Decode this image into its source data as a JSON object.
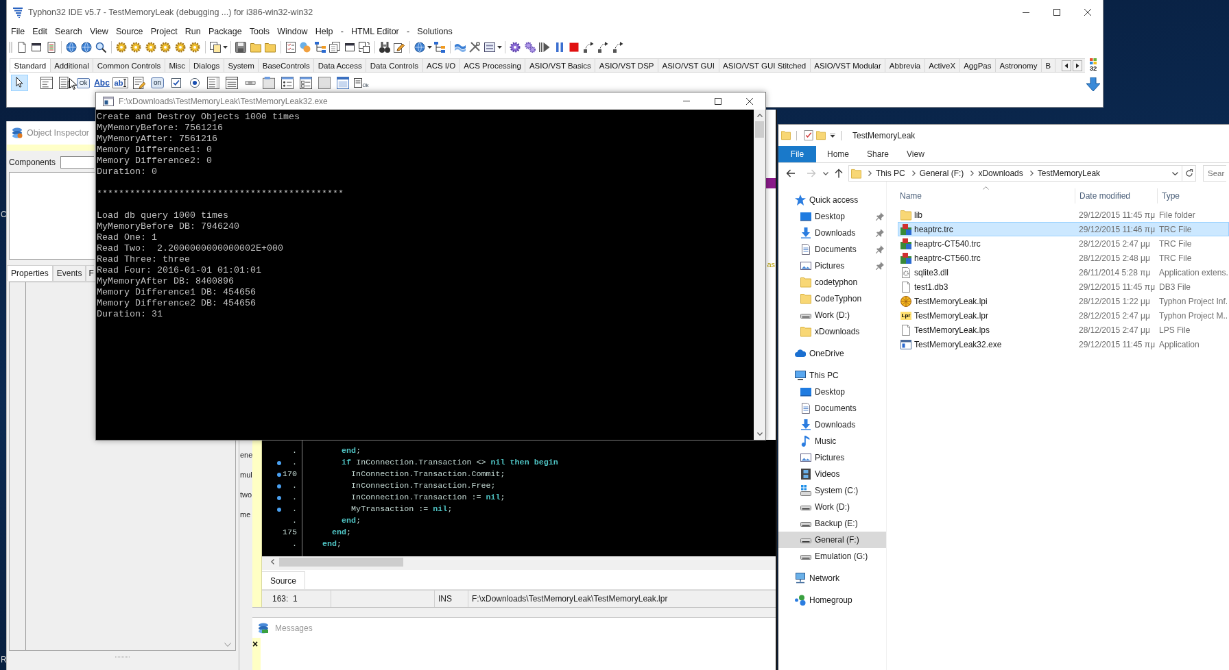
{
  "desktop": {
    "label_fragments": [
      "C",
      "R"
    ]
  },
  "ide_window": {
    "title": "Typhon32 IDE v5.7 - TestMemoryLeak (debugging ...) for i386-win32-win32",
    "menu": [
      "File",
      "Edit",
      "Search",
      "View",
      "Source",
      "Project",
      "Run",
      "Package",
      "Tools",
      "Window",
      "Help",
      "-",
      "HTML Editor",
      "-",
      "Solutions"
    ],
    "palette_tabs": [
      {
        "label": "Standard",
        "selected": true
      },
      {
        "label": "Additional",
        "selected": false
      },
      {
        "label": "Common Controls",
        "selected": false
      },
      {
        "label": "Misc",
        "selected": false
      },
      {
        "label": "Dialogs",
        "selected": false
      },
      {
        "label": "System",
        "selected": false
      },
      {
        "label": "BaseControls",
        "selected": false
      },
      {
        "label": "Data Access",
        "selected": false
      },
      {
        "label": "Data Controls",
        "selected": false
      },
      {
        "label": "ACS I/O",
        "selected": false
      },
      {
        "label": "ACS Processing",
        "selected": false
      },
      {
        "label": "ASIO/VST Basics",
        "selected": false
      },
      {
        "label": "ASIO/VST DSP",
        "selected": false
      },
      {
        "label": "ASIO/VST GUI",
        "selected": false
      },
      {
        "label": "ASIO/VST GUI Stitched",
        "selected": false
      },
      {
        "label": "ASIO/VST Modular",
        "selected": false
      },
      {
        "label": "Abbrevia",
        "selected": false
      },
      {
        "label": "ActiveX",
        "selected": false
      },
      {
        "label": "AggPas",
        "selected": false
      },
      {
        "label": "Astronomy",
        "selected": false
      },
      {
        "label": "B",
        "selected": false
      }
    ],
    "palette_items": [
      {
        "kind": "pointer",
        "selected": true
      },
      {
        "kind": "menu",
        "selected": false
      },
      {
        "kind": "popup",
        "selected": false
      },
      {
        "kind": "button",
        "glyph": "Ok",
        "selected": false
      },
      {
        "kind": "label",
        "glyph": "Abc",
        "selected": false
      },
      {
        "kind": "edit",
        "glyph": "ab",
        "selected": false
      },
      {
        "kind": "memo",
        "selected": false
      },
      {
        "kind": "toggle",
        "glyph": "on",
        "selected": false
      },
      {
        "kind": "checkbox",
        "selected": false
      },
      {
        "kind": "radio",
        "selected": false
      },
      {
        "kind": "listbox",
        "selected": false
      },
      {
        "kind": "combobox",
        "selected": false
      },
      {
        "kind": "scrollbar",
        "selected": false
      },
      {
        "kind": "groupbox",
        "selected": false
      },
      {
        "kind": "radiogroup",
        "selected": false
      },
      {
        "kind": "checkgroup",
        "selected": false
      },
      {
        "kind": "panel",
        "selected": false
      },
      {
        "kind": "frame",
        "selected": false
      },
      {
        "kind": "actions",
        "glyph": "Ok",
        "selected": false
      }
    ],
    "palette_badge": "32"
  },
  "object_inspector": {
    "title": "Object Inspector",
    "components_label": "Components",
    "tabs": [
      {
        "label": "Properties",
        "selected": true
      },
      {
        "label": "Events",
        "selected": false
      },
      {
        "label": "F",
        "selected": false
      }
    ]
  },
  "left_panel": {
    "texts": [
      "ene",
      "mul",
      "two",
      "me"
    ]
  },
  "source_editor": {
    "side_fragment": "as",
    "lines": [
      {
        "number": ".",
        "marked": false,
        "code": "      **end**;"
      },
      {
        "number": ".",
        "marked": true,
        "code": "      **if** InConnection.Transaction <> **nil** **then** **begin**"
      },
      {
        "number": "170",
        "marked": true,
        "code": "        InConnection.Transaction.Commit;"
      },
      {
        "number": ".",
        "marked": true,
        "code": "        InConnection.Transaction.Free;"
      },
      {
        "number": ".",
        "marked": true,
        "code": "        InConnection.Transaction := **nil**;"
      },
      {
        "number": ".",
        "marked": true,
        "code": "        MyTransaction := **nil**;"
      },
      {
        "number": ".",
        "marked": false,
        "code": "      **end**;"
      },
      {
        "number": "175",
        "marked": false,
        "code": "    **end**;"
      },
      {
        "number": ".",
        "marked": false,
        "code": "  **end**;"
      }
    ],
    "tabs": [
      {
        "label": "Source",
        "selected": true
      }
    ],
    "status_bar": {
      "cursor": "163:  1",
      "mode": "INS",
      "file": "F:\\xDownloads\\TestMemoryLeak\\TestMemoryLeak.lpr"
    }
  },
  "messages_window": {
    "title": "Messages",
    "close_mark": "×"
  },
  "console_window": {
    "title": "F:\\xDownloads\\TestMemoryLeak\\TestMemoryLeak32.exe",
    "output_blocks": [
      [
        "Create and Destroy Objects 1000 times",
        "MyMemoryBefore: 7561216",
        "MyMemoryAfter: 7561216",
        "Memory Difference1: 0",
        "Memory Difference2: 0",
        "Duration: 0"
      ],
      [
        "*********************************************"
      ],
      [
        "Load db query 1000 times",
        "MyMemoryBefore DB: 7946240",
        "Read One: 1",
        "Read Two:  2.2000000000000002E+000",
        "Read Three: three",
        "Read Four: 2016-01-01 01:01:01",
        "MyMemoryAfter DB: 8400896",
        "Memory Difference1 DB: 454656",
        "Memory Difference2 DB: 454656",
        "Duration: 31"
      ]
    ]
  },
  "explorer_window": {
    "title": "TestMemoryLeak",
    "ribbon_tabs": [
      {
        "label": "File",
        "kind": "menu"
      },
      {
        "label": "Home",
        "kind": "tab"
      },
      {
        "label": "Share",
        "kind": "tab"
      },
      {
        "label": "View",
        "kind": "tab"
      }
    ],
    "nav_buttons": {
      "back_enabled": true,
      "forward_enabled": false
    },
    "address": [
      "This PC",
      "General (F:)",
      "xDownloads",
      "TestMemoryLeak"
    ],
    "search": {
      "placeholder": "Sear"
    },
    "nav": [
      {
        "label": "Quick access",
        "kind": "quick",
        "selected": false,
        "children": [
          {
            "label": "Desktop",
            "kind": "desktop",
            "pinned": true,
            "selected": false
          },
          {
            "label": "Downloads",
            "kind": "downloads",
            "pinned": true,
            "selected": false
          },
          {
            "label": "Documents",
            "kind": "documents",
            "pinned": true,
            "selected": false
          },
          {
            "label": "Pictures",
            "kind": "pictures",
            "pinned": true,
            "selected": false
          },
          {
            "label": "codetyphon",
            "kind": "folder",
            "pinned": false,
            "selected": false
          },
          {
            "label": "CodeTyphon",
            "kind": "folder",
            "pinned": false,
            "selected": false
          },
          {
            "label": "Work (D:)",
            "kind": "drive",
            "pinned": false,
            "selected": false
          },
          {
            "label": "xDownloads",
            "kind": "folder",
            "pinned": false,
            "selected": false
          }
        ]
      },
      {
        "label": "OneDrive",
        "kind": "cloud",
        "selected": false
      },
      {
        "label": "This PC",
        "kind": "computer",
        "selected": false,
        "children": [
          {
            "label": "Desktop",
            "kind": "desktop",
            "selected": false
          },
          {
            "label": "Documents",
            "kind": "documents",
            "selected": false
          },
          {
            "label": "Downloads",
            "kind": "downloads",
            "selected": false
          },
          {
            "label": "Music",
            "kind": "music",
            "selected": false
          },
          {
            "label": "Pictures",
            "kind": "pictures",
            "selected": false
          },
          {
            "label": "Videos",
            "kind": "videos",
            "selected": false
          },
          {
            "label": "System (C:)",
            "kind": "system",
            "selected": false
          },
          {
            "label": "Work (D:)",
            "kind": "drive",
            "selected": false
          },
          {
            "label": "Backup (E:)",
            "kind": "drive",
            "selected": false
          },
          {
            "label": "General (F:)",
            "kind": "drive",
            "selected": true
          },
          {
            "label": "Emulation (G:)",
            "kind": "drive",
            "selected": false
          }
        ]
      },
      {
        "label": "Network",
        "kind": "network",
        "selected": false
      },
      {
        "label": "Homegroup",
        "kind": "homegroup",
        "selected": false
      }
    ],
    "columns": [
      {
        "label": "Name",
        "sorted": true
      },
      {
        "label": "Date modified",
        "sorted": false
      },
      {
        "label": "Type",
        "sorted": false
      }
    ],
    "files": [
      {
        "name": "lib",
        "date": "29/12/2015 11:45 πμ",
        "type": "File folder",
        "kind": "folder",
        "selected": false
      },
      {
        "name": "heaptrc.trc",
        "date": "29/12/2015 11:46 πμ",
        "type": "TRC File",
        "kind": "trc",
        "selected": true
      },
      {
        "name": "heaptrc-CT540.trc",
        "date": "28/12/2015 2:47 μμ",
        "type": "TRC File",
        "kind": "trc",
        "selected": false
      },
      {
        "name": "heaptrc-CT560.trc",
        "date": "28/12/2015 2:48 μμ",
        "type": "TRC File",
        "kind": "trc",
        "selected": false
      },
      {
        "name": "sqlite3.dll",
        "date": "26/11/2014 5:28 πμ",
        "type": "Application extens.",
        "kind": "dll",
        "selected": false
      },
      {
        "name": "test1.db3",
        "date": "29/12/2015 11:45 πμ",
        "type": "DB3 File",
        "kind": "file",
        "selected": false
      },
      {
        "name": "TestMemoryLeak.lpi",
        "date": "28/12/2015 1:22 μμ",
        "type": "Typhon Project Inf.",
        "kind": "lpi",
        "selected": false
      },
      {
        "name": "TestMemoryLeak.lpr",
        "date": "28/12/2015 2:47 μμ",
        "type": "Typhon Project M..",
        "kind": "lpr",
        "icon_text": "Lpr",
        "selected": false
      },
      {
        "name": "TestMemoryLeak.lps",
        "date": "28/12/2015 2:47 μμ",
        "type": "LPS File",
        "kind": "file",
        "selected": false
      },
      {
        "name": "TestMemoryLeak32.exe",
        "date": "29/12/2015 11:45 πμ",
        "type": "Application",
        "kind": "exe",
        "selected": false
      }
    ]
  }
}
